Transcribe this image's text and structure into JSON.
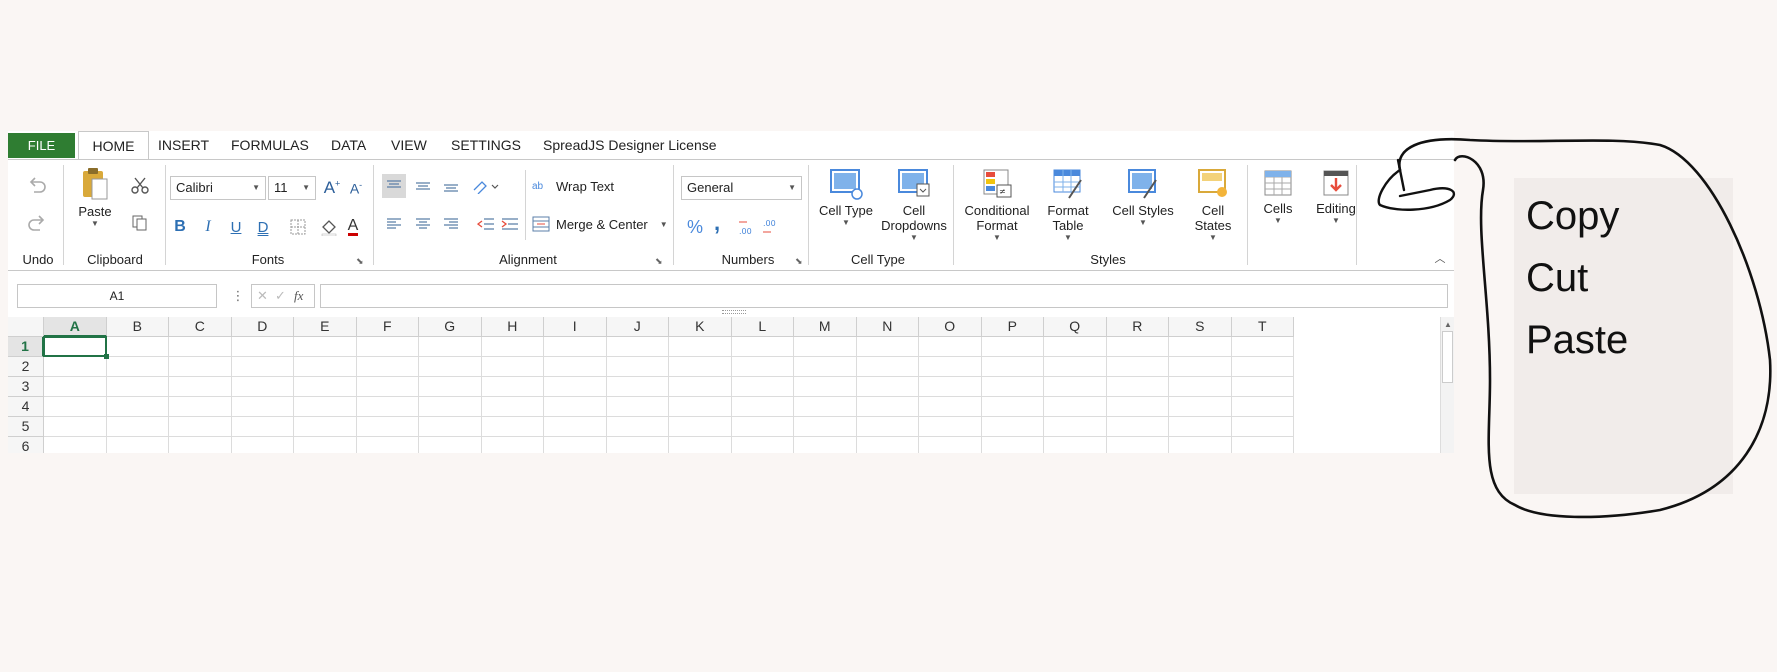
{
  "tabs": {
    "file": "FILE",
    "home": "HOME",
    "insert": "INSERT",
    "formulas": "FORMULAS",
    "data": "DATA",
    "view": "VIEW",
    "settings": "SETTINGS",
    "license": "SpreadJS Designer License"
  },
  "ribbon": {
    "undo_group": "Undo",
    "clipboard": {
      "group": "Clipboard",
      "paste": "Paste"
    },
    "fonts": {
      "group": "Fonts",
      "font_name": "Calibri",
      "font_size": "11",
      "bold": "B",
      "italic": "I",
      "underline": "U",
      "double_underline": "D",
      "font_color": "A"
    },
    "alignment": {
      "group": "Alignment",
      "wrap_text": "Wrap Text",
      "merge_center": "Merge & Center",
      "wrap_glyph": "ab"
    },
    "numbers": {
      "group": "Numbers",
      "format": "General",
      "percent": "%",
      "comma": ","
    },
    "cell_type": {
      "group": "Cell Type",
      "cell_type": "Cell Type",
      "cell_dropdowns_1": "Cell",
      "cell_dropdowns_2": "Dropdowns"
    },
    "styles": {
      "group": "Styles",
      "conditional_1": "Conditional",
      "conditional_2": "Format",
      "format_table_1": "Format",
      "format_table_2": "Table",
      "cell_styles": "Cell Styles",
      "cell_states_1": "Cell",
      "cell_states_2": "States"
    },
    "cells": "Cells",
    "editing": "Editing"
  },
  "formula_bar": {
    "name_box": "A1",
    "fx": "fx",
    "formula": ""
  },
  "grid": {
    "columns": [
      "A",
      "B",
      "C",
      "D",
      "E",
      "F",
      "G",
      "H",
      "I",
      "J",
      "K",
      "L",
      "M",
      "N",
      "O",
      "P",
      "Q",
      "R",
      "S",
      "T"
    ],
    "rows": [
      "1",
      "2",
      "3",
      "4",
      "5",
      "6"
    ],
    "selected_cell": "A1"
  },
  "context_menu": {
    "items": [
      "Copy",
      "Cut",
      "Paste"
    ]
  },
  "colors": {
    "file_tab": "#2f7d32",
    "selection": "#217346",
    "accent_blue": "#4a89dc",
    "accent_red": "#e74c3c"
  }
}
